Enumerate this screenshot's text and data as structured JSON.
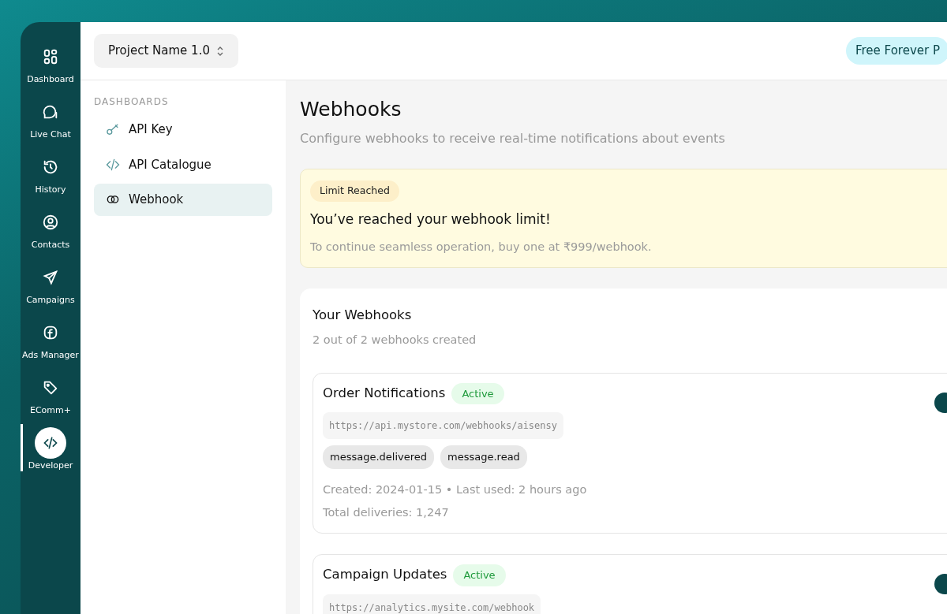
{
  "rail": [
    {
      "label": "Dashboard",
      "selected": false
    },
    {
      "label": "Live Chat",
      "selected": false
    },
    {
      "label": "History",
      "selected": false
    },
    {
      "label": "Contacts",
      "selected": false
    },
    {
      "label": "Campaigns",
      "selected": false
    },
    {
      "label": "Ads Manager",
      "selected": false
    },
    {
      "label": "EComm+",
      "selected": false
    },
    {
      "label": "Developer",
      "selected": true
    }
  ],
  "project_select": {
    "value": "Project Name 1.0"
  },
  "plan_badge": "Free Forever P",
  "subnav": {
    "heading": "DASHBOARDS",
    "items": [
      {
        "label": "API Key",
        "selected": false
      },
      {
        "label": "API Catalogue",
        "selected": false
      },
      {
        "label": "Webhook",
        "selected": true
      }
    ]
  },
  "page": {
    "title": "Webhooks",
    "subtitle": "Configure webhooks to receive real-time notifications about events"
  },
  "limit_alert": {
    "badge": "Limit Reached",
    "title": "You’ve reached your webhook limit!",
    "text": "To continue seamless operation, buy one at ₹999/webhook."
  },
  "webhooks_panel": {
    "title": "Your Webhooks",
    "subtitle": "2 out of 2 webhooks created",
    "webhooks": [
      {
        "name": "Order Notifications",
        "status": "Active",
        "url": "https://api.mystore.com/webhooks/aisensy",
        "events": [
          "message.delivered",
          "message.read"
        ],
        "meta": "Created: 2024-01-15 • Last used: 2 hours ago",
        "deliveries": "Total deliveries: 1,247"
      },
      {
        "name": "Campaign Updates",
        "status": "Active",
        "url": "https://analytics.mysite.com/webhook"
      }
    ]
  }
}
